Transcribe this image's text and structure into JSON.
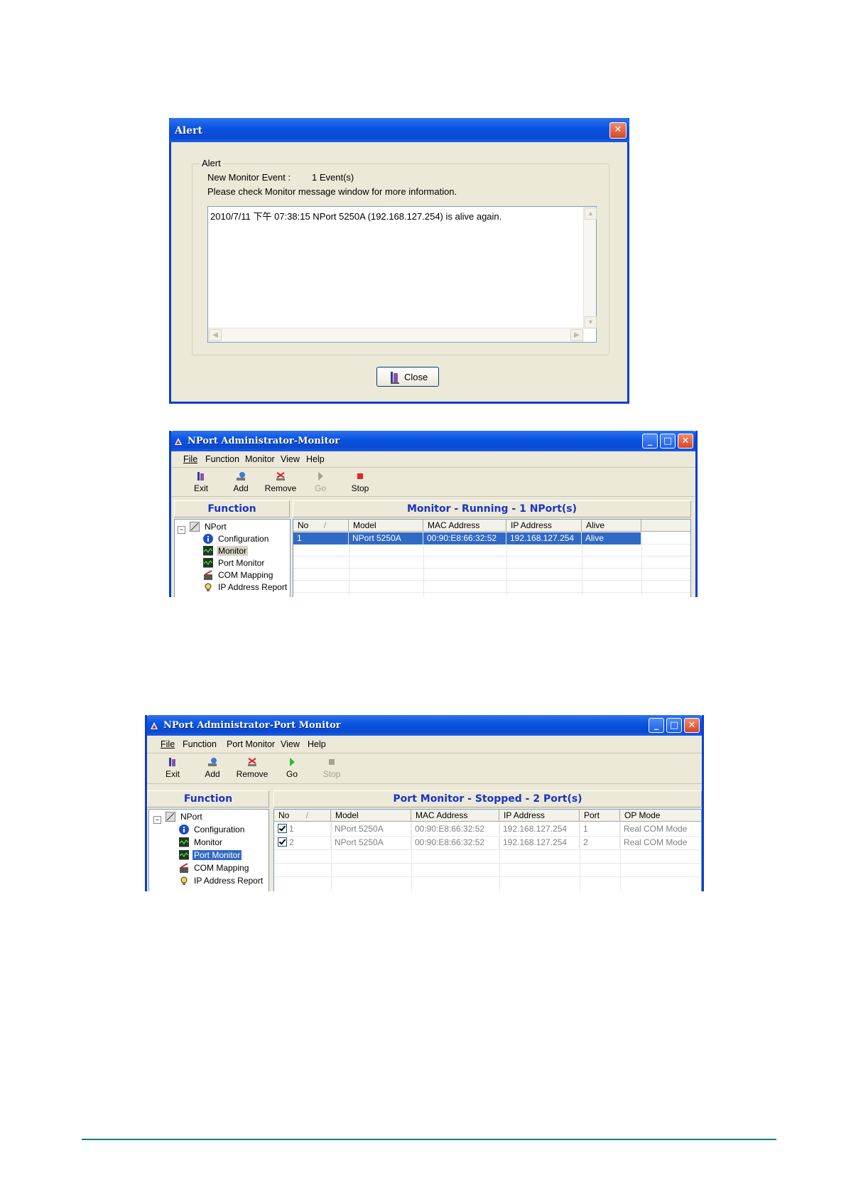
{
  "alert": {
    "title": "Alert",
    "group_label": "Alert",
    "event_label": "New Monitor Event :",
    "event_count": "1 Event(s)",
    "info": "Please check Monitor message window for more information.",
    "message": "2010/7/11 下午 07:38:15 NPort 5250A (192.168.127.254) is alive again.",
    "close_button": "Close"
  },
  "monitor_window": {
    "title": "NPort Administrator-Monitor",
    "menu": [
      "File",
      "Function",
      "Monitor",
      "View",
      "Help"
    ],
    "toolbar": [
      "Exit",
      "Add",
      "Remove",
      "Go",
      "Stop"
    ],
    "function_header": "Function",
    "panel_header": "Monitor - Running - 1 NPort(s)",
    "tree": [
      "NPort",
      "Configuration",
      "Monitor",
      "Port Monitor",
      "COM Mapping",
      "IP Address Report"
    ],
    "columns": [
      "No",
      "Model",
      "MAC Address",
      "IP Address",
      "Alive"
    ],
    "rows": [
      {
        "no": "1",
        "model": "NPort 5250A",
        "mac": "00:90:E8:66:32:52",
        "ip": "192.168.127.254",
        "alive": "Alive"
      }
    ]
  },
  "port_window": {
    "title": "NPort Administrator-Port Monitor",
    "menu": [
      "File",
      "Function",
      "Port Monitor",
      "View",
      "Help"
    ],
    "toolbar": [
      "Exit",
      "Add",
      "Remove",
      "Go",
      "Stop"
    ],
    "function_header": "Function",
    "panel_header": "Port Monitor - Stopped - 2 Port(s)",
    "tree": [
      "NPort",
      "Configuration",
      "Monitor",
      "Port Monitor",
      "COM Mapping",
      "IP Address Report"
    ],
    "columns": [
      "No",
      "Model",
      "MAC Address",
      "IP Address",
      "Port",
      "OP Mode"
    ],
    "rows": [
      {
        "no": "1",
        "model": "NPort 5250A",
        "mac": "00:90:E8:66:32:52",
        "ip": "192.168.127.254",
        "port": "1",
        "mode": "Real COM Mode"
      },
      {
        "no": "2",
        "model": "NPort 5250A",
        "mac": "00:90:E8:66:32:52",
        "ip": "192.168.127.254",
        "port": "2",
        "mode": "Real COM Mode"
      }
    ]
  },
  "colors": {
    "accent": "#0a4ad0",
    "selection": "#316ac5",
    "footer_line": "#008080"
  }
}
